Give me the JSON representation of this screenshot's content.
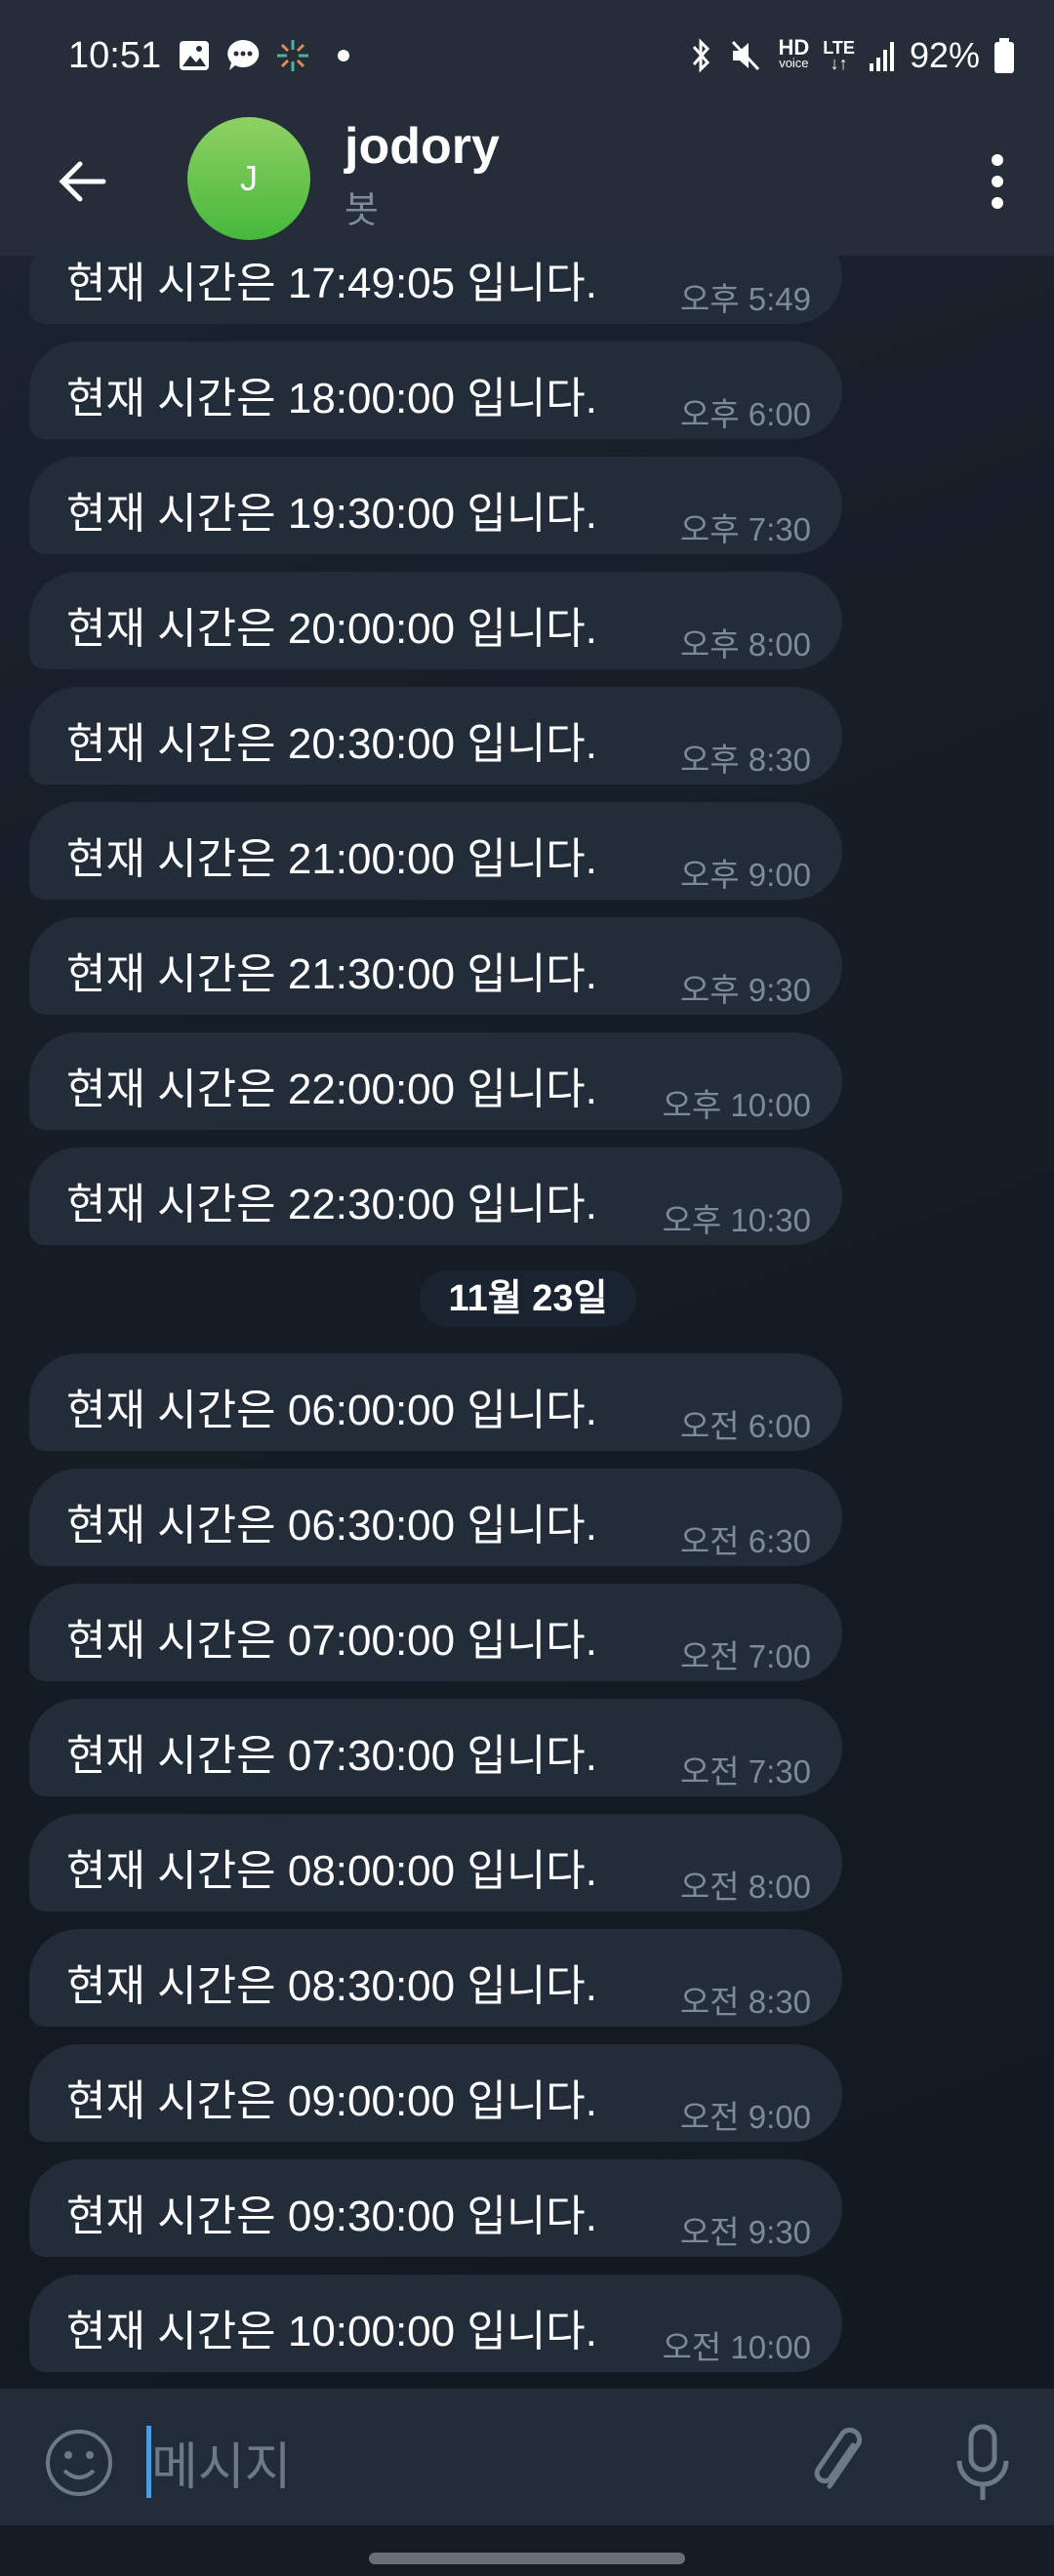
{
  "status_bar": {
    "time": "10:51",
    "battery": "92%",
    "icons": [
      "gallery-icon",
      "chat-icon",
      "app-icon",
      "dot-icon",
      "bluetooth-icon",
      "mute-icon",
      "hd-voice-icon",
      "lte-icon",
      "signal-icon",
      "battery-icon"
    ],
    "hd": "HD",
    "voice": "voice",
    "lte": "LTE"
  },
  "header": {
    "avatar_letter": "J",
    "title": "jodory",
    "subtitle": "봇",
    "avatar_color": "#5cc24a"
  },
  "messages_before": [
    {
      "text": "현재 시간은 17:49:05 입니다.",
      "time": "오후 5:49"
    },
    {
      "text": "현재 시간은 18:00:00 입니다.",
      "time": "오후 6:00"
    },
    {
      "text": "현재 시간은 19:30:00 입니다.",
      "time": "오후 7:30"
    },
    {
      "text": "현재 시간은 20:00:00 입니다.",
      "time": "오후 8:00"
    },
    {
      "text": "현재 시간은 20:30:00 입니다.",
      "time": "오후 8:30"
    },
    {
      "text": "현재 시간은 21:00:00 입니다.",
      "time": "오후 9:00"
    },
    {
      "text": "현재 시간은 21:30:00 입니다.",
      "time": "오후 9:30"
    },
    {
      "text": "현재 시간은 22:00:00 입니다.",
      "time": "오후 10:00"
    },
    {
      "text": "현재 시간은 22:30:00 입니다.",
      "time": "오후 10:30"
    }
  ],
  "date_separator": "11월 23일",
  "messages_after": [
    {
      "text": "현재 시간은 06:00:00 입니다.",
      "time": "오전 6:00"
    },
    {
      "text": "현재 시간은 06:30:00 입니다.",
      "time": "오전 6:30"
    },
    {
      "text": "현재 시간은 07:00:00 입니다.",
      "time": "오전 7:00"
    },
    {
      "text": "현재 시간은 07:30:00 입니다.",
      "time": "오전 7:30"
    },
    {
      "text": "현재 시간은 08:00:00 입니다.",
      "time": "오전 8:00"
    },
    {
      "text": "현재 시간은 08:30:00 입니다.",
      "time": "오전 8:30"
    },
    {
      "text": "현재 시간은 09:00:00 입니다.",
      "time": "오전 9:00"
    },
    {
      "text": "현재 시간은 09:30:00 입니다.",
      "time": "오전 9:30"
    },
    {
      "text": "현재 시간은 10:00:00 입니다.",
      "time": "오전 10:00"
    }
  ],
  "composer": {
    "placeholder": "메시지"
  }
}
